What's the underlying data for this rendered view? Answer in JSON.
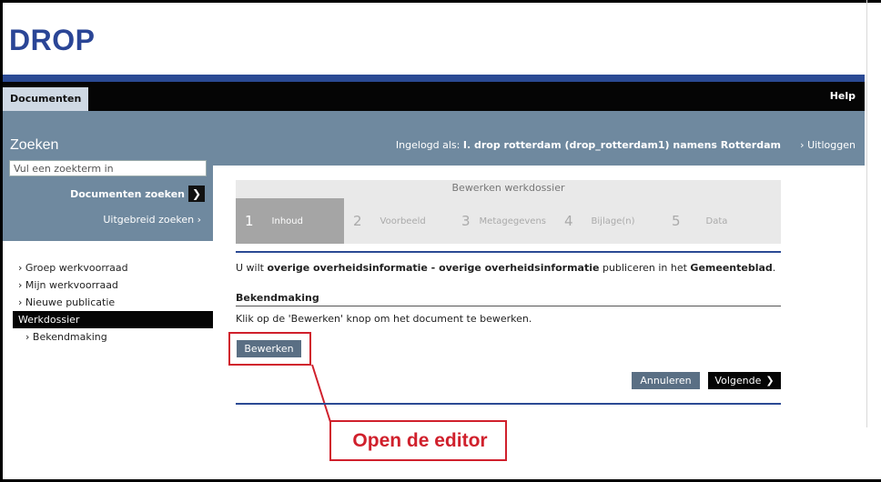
{
  "app": {
    "logo": "DROP"
  },
  "topnav": {
    "documents_tab": "Documenten",
    "help": "Help"
  },
  "header": {
    "section_title": "Zoeken",
    "login_prefix": "Ingelogd als:",
    "login_user": "I. drop rotterdam (drop_rotterdam1) namens Rotterdam",
    "logout": "Uitloggen"
  },
  "search": {
    "placeholder": "Vul een zoekterm in",
    "documents_search": "Documenten zoeken",
    "advanced_search": "Uitgebreid zoeken"
  },
  "sidebar": {
    "items": [
      {
        "label": "Groep werkvoorraad"
      },
      {
        "label": "Mijn werkvoorraad"
      },
      {
        "label": "Nieuwe publicatie"
      },
      {
        "label": "Werkdossier"
      },
      {
        "label": "Bekendmaking"
      }
    ]
  },
  "wizard": {
    "title": "Bewerken werkdossier",
    "steps": [
      {
        "num": "1",
        "label": "Inhoud"
      },
      {
        "num": "2",
        "label": "Voorbeeld"
      },
      {
        "num": "3",
        "label": "Metagegevens"
      },
      {
        "num": "4",
        "label": "Bijlage(n)"
      },
      {
        "num": "5",
        "label": "Data"
      }
    ]
  },
  "main": {
    "intro_start": "U wilt ",
    "intro_bold1": "overige overheidsinformatie - overige overheidsinformatie",
    "intro_mid": " publiceren in het ",
    "intro_bold2": "Gemeenteblad",
    "intro_end": ".",
    "section_heading": "Bekendmaking",
    "section_text": "Klik op de 'Bewerken' knop om het document te bewerken.",
    "edit_button": "Bewerken",
    "cancel_button": "Annuleren",
    "next_button": "Volgende"
  },
  "annotation": {
    "label": "Open de editor",
    "color": "#d0202c"
  },
  "colors": {
    "brand_blue": "#2b4a94",
    "header_gray_blue": "#6f899f"
  }
}
